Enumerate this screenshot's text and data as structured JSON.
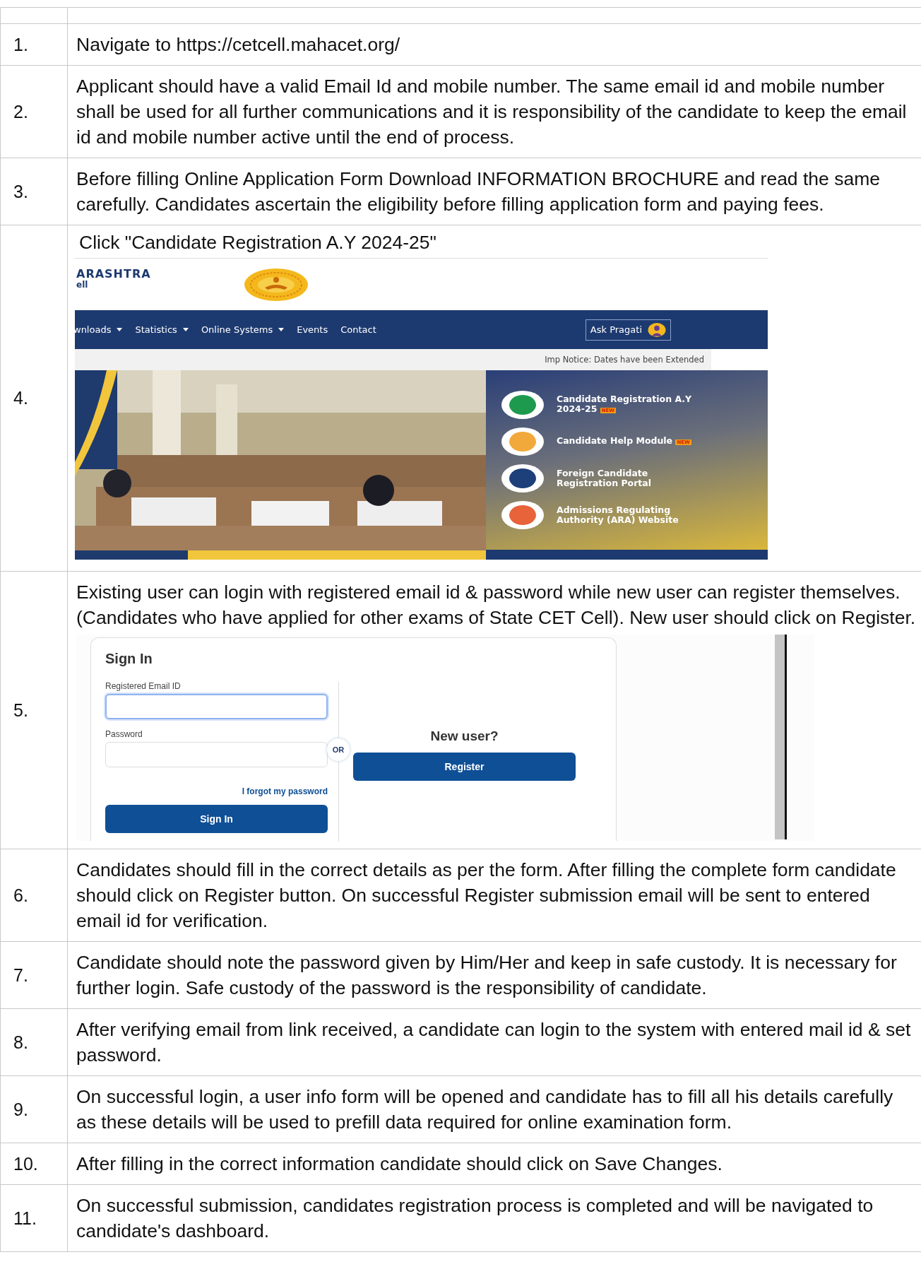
{
  "rows": [
    {
      "number": "1.",
      "kind": "text",
      "text": "Navigate to https://cetcell.mahacet.org/"
    },
    {
      "number": "2.",
      "kind": "text",
      "text": "Applicant should have a valid Email Id and mobile number. The same email id and mobile number shall be used for all further communications and it is responsibility of the candidate to keep the email id and mobile number active until the end of process."
    },
    {
      "number": "3.",
      "kind": "text",
      "text": "Before filling Online Application Form Download INFORMATION BROCHURE and read the same carefully. Candidates ascertain the eligibility before filling application form and paying fees."
    },
    {
      "number": "4.",
      "kind": "portal",
      "text": "Click \"Candidate Registration A.Y 2024-25\"",
      "portal": {
        "brand": "ARASHTRA",
        "brand_sub": "ell",
        "nav": [
          {
            "label": "wnloads",
            "dropdown": true
          },
          {
            "label": "Statistics",
            "dropdown": true
          },
          {
            "label": "Online Systems",
            "dropdown": true
          },
          {
            "label": "Events",
            "dropdown": false
          },
          {
            "label": "Contact",
            "dropdown": false
          }
        ],
        "ask_button": "Ask Pragati",
        "notice": "Imp Notice: Dates have been Extended",
        "links": [
          {
            "title": "Candidate Registration A.Y 2024-25",
            "badge": "NEW",
            "color": "#1e9a4e"
          },
          {
            "title": "Candidate Help Module",
            "badge": "NEW",
            "color": "#f2a93b"
          },
          {
            "title": "Foreign Candidate Registration Portal",
            "color": "#1d3f7a"
          },
          {
            "title": "Admissions Regulating Authority (ARA) Website",
            "color": "#e8623a"
          }
        ]
      }
    },
    {
      "number": "5.",
      "kind": "signin",
      "text": "Existing user can login with registered email id & password while new user can register themselves. (Candidates who have applied for other exams of State CET Cell). New user should click on Register.",
      "signin": {
        "title": "Sign In",
        "fields": [
          {
            "label": "Registered Email ID",
            "focused": true
          },
          {
            "label": "Password",
            "focused": false
          }
        ],
        "forgot": "I forgot my password",
        "button": "Sign In",
        "or": "OR",
        "new_user": "New user?",
        "register": "Register"
      }
    },
    {
      "number": "6.",
      "kind": "text",
      "text": "Candidates should fill in the correct details as per the form. After filling the complete form candidate should click on Register button. On successful Register submission email will be sent to entered email id for verification."
    },
    {
      "number": "7.",
      "kind": "text",
      "text": "Candidate should note the password given by Him/Her and keep in safe custody. It is necessary for further login. Safe custody of the password is the responsibility of candidate."
    },
    {
      "number": "8.",
      "kind": "text",
      "text": "After verifying email from link received, a candidate can login to the system with entered mail id & set password."
    },
    {
      "number": "9.",
      "kind": "text",
      "text": "On successful login, a user info form will be opened and candidate has to fill all his details carefully as these details will be used to prefill data required for online examination form."
    },
    {
      "number": "10.",
      "kind": "text",
      "text": "After filling in the correct information candidate should click on Save Changes."
    },
    {
      "number": "11.",
      "kind": "text",
      "text": "On successful submission, candidates registration process is completed and will be navigated to candidate's dashboard."
    }
  ]
}
